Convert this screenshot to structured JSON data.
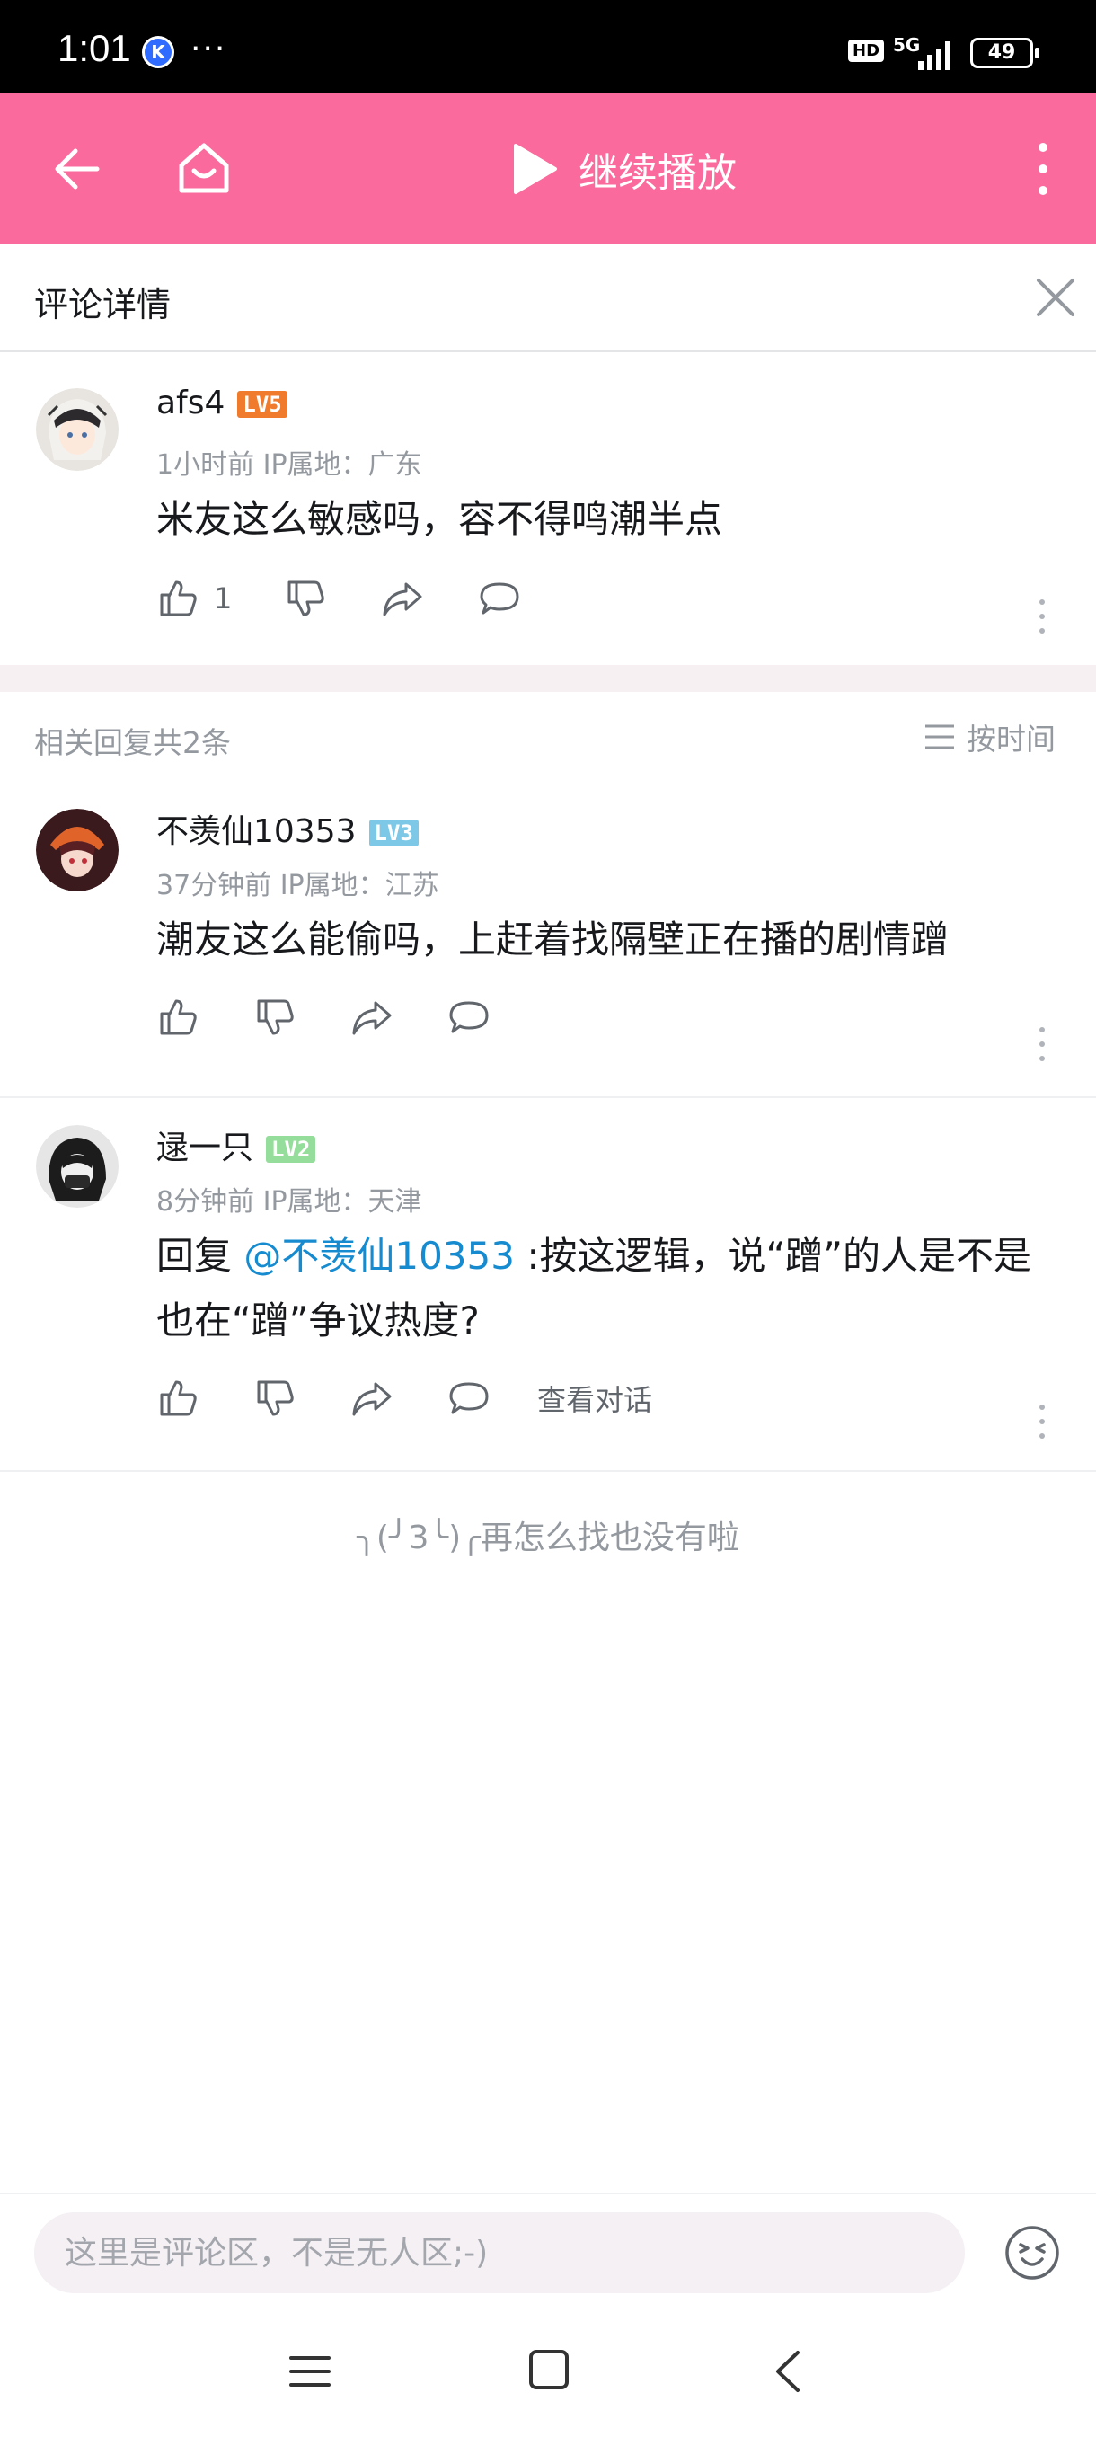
{
  "status_bar": {
    "time": "1:01",
    "app_badge": "K",
    "more": "···",
    "hd": "HD",
    "network": "5G",
    "battery": "49"
  },
  "header": {
    "continue_play_label": "继续播放",
    "accent_color": "#fb6a9c"
  },
  "detail": {
    "title": "评论详情"
  },
  "root_comment": {
    "username": "afs4",
    "level": "LV5",
    "level_color": "#f07b2c",
    "meta": "1小时前 IP属地：广东",
    "content": "米友这么敏感吗，容不得鸣潮半点",
    "like_count": "1"
  },
  "replies_header": {
    "count_text": "相关回复共2条",
    "sort_label": "按时间"
  },
  "replies": [
    {
      "username": "不羡仙10353",
      "level": "LV3",
      "level_color": "#7dc8e6",
      "meta": "37分钟前 IP属地：江苏",
      "content": "潮友这么能偷吗，上赶着找隔壁正在播的剧情蹭"
    },
    {
      "username": "逯一只",
      "level": "LV2",
      "level_color": "#95dd9a",
      "meta": "8分钟前 IP属地：天津",
      "content_prefix": "回复 ",
      "mention": "@不羡仙10353",
      "content_rest": " :按这逻辑，说“蹭”的人是不是也在“蹭”争议热度?",
      "view_dialog": "查看对话"
    }
  ],
  "end_tip": "╮(╯3╰)╭再怎么找也没有啦",
  "input": {
    "placeholder": "这里是评论区，不是无人区;-)"
  }
}
